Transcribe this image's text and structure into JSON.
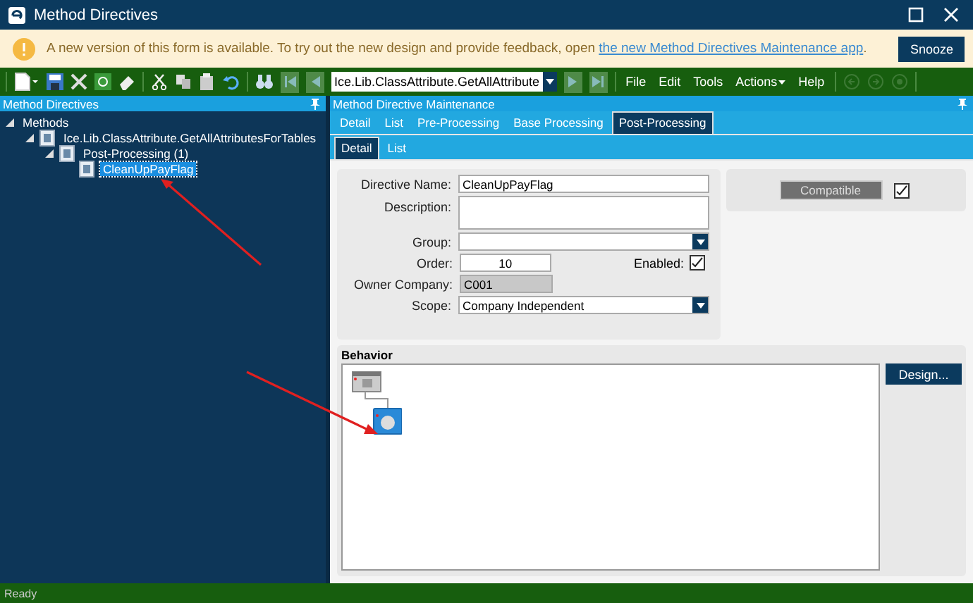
{
  "window": {
    "title": "Method Directives"
  },
  "banner": {
    "message": "A new version of this form is available. To try out the new design and provide feedback, open ",
    "link": "the new Method Directives Maintenance app",
    "end": ".",
    "button": "Snooze"
  },
  "toolbar": {
    "record": "Ice.Lib.ClassAttribute.GetAllAttribute",
    "menus": [
      {
        "label": "File",
        "dropdown": false
      },
      {
        "label": "Edit",
        "dropdown": false
      },
      {
        "label": "Tools",
        "dropdown": false
      },
      {
        "label": "Actions",
        "dropdown": true
      },
      {
        "label": "Help",
        "dropdown": false
      }
    ]
  },
  "left_panel": {
    "title": "Method Directives",
    "tree": [
      {
        "label": "Methods",
        "expanded": true,
        "selected": false,
        "children": [
          {
            "label": "Ice.Lib.ClassAttribute.GetAllAttributesForTables",
            "expanded": true,
            "selected": false,
            "children": [
              {
                "label": "Post-Processing (1)",
                "expanded": true,
                "selected": false,
                "children": [
                  {
                    "label": "CleanUpPayFlag",
                    "selected": true
                  }
                ]
              }
            ]
          }
        ]
      }
    ]
  },
  "right_panel": {
    "title": "Method Directive Maintenance",
    "tabs": [
      {
        "label": "Detail",
        "selected": false
      },
      {
        "label": "List",
        "selected": false
      },
      {
        "label": "Pre-Processing",
        "selected": false
      },
      {
        "label": "Base Processing",
        "selected": false
      },
      {
        "label": "Post-Processing",
        "selected": true
      }
    ],
    "subtabs": [
      {
        "label": "Detail",
        "selected": true
      },
      {
        "label": "List",
        "selected": false
      }
    ],
    "form": {
      "directive_name": {
        "label": "Directive Name:",
        "value": "CleanUpPayFlag"
      },
      "description": {
        "label": "Description:"
      },
      "group": {
        "label": "Group:"
      },
      "order": {
        "label": "Order:",
        "value": "10"
      },
      "enabled": {
        "label": "Enabled:",
        "checked": true
      },
      "owner_company": {
        "label": "Owner Company:",
        "value": "C001"
      },
      "scope": {
        "label": "Scope:",
        "value": "Company Independent"
      }
    },
    "compatible": {
      "label": "Compatible",
      "checked": true
    },
    "behavior": {
      "title": "Behavior",
      "button": "Design..."
    }
  },
  "status_bar": {
    "text": "Ready"
  }
}
